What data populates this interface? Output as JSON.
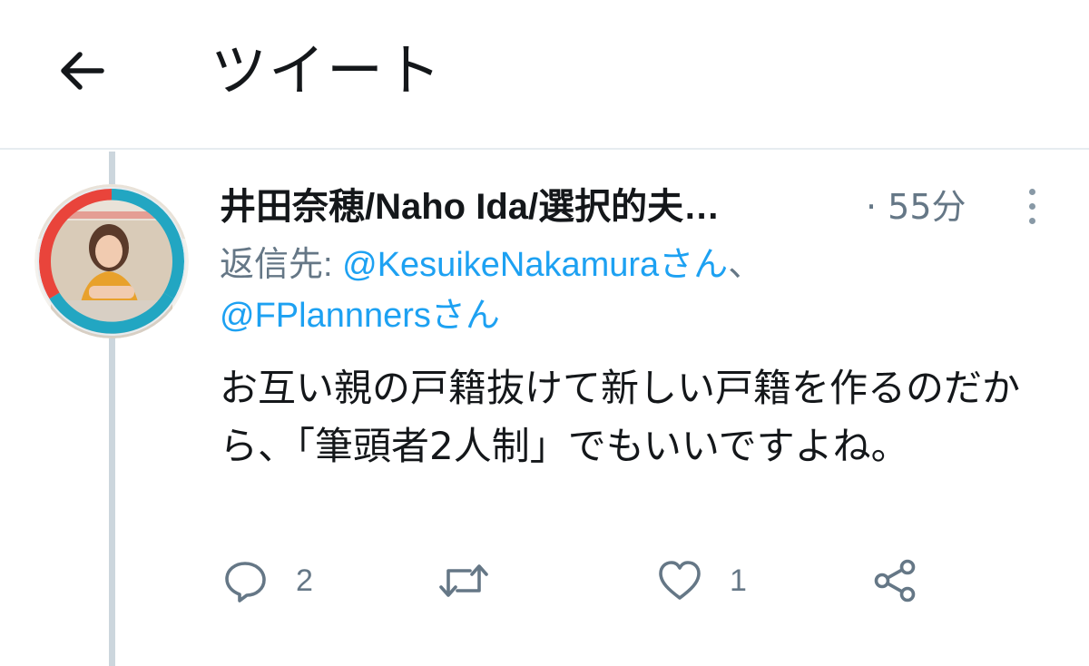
{
  "header": {
    "title": "ツイート",
    "back_icon": "arrow-left-icon"
  },
  "tweet": {
    "author": {
      "display_name": "井田奈穂/Naho Ida/選択的夫…",
      "avatar_icon": "profile-photo"
    },
    "timestamp": "· 55分",
    "reply_to": {
      "prefix": "返信先: ",
      "mention_1": "@KesuikeNakamuraさん",
      "separator": "、",
      "mention_2": "@FPlannnersさん"
    },
    "text": "お互い親の戸籍抜けて新しい戸籍を作るのだから、「筆頭者2人制」でもいいですよね。",
    "actions": {
      "reply_count": "2",
      "retweet_count": "",
      "like_count": "1"
    }
  },
  "colors": {
    "link": "#1da1f2",
    "secondary_text": "#657786",
    "primary_text": "#14171a",
    "divider": "#e6ecf0",
    "thread_line": "#ccd6dd"
  }
}
